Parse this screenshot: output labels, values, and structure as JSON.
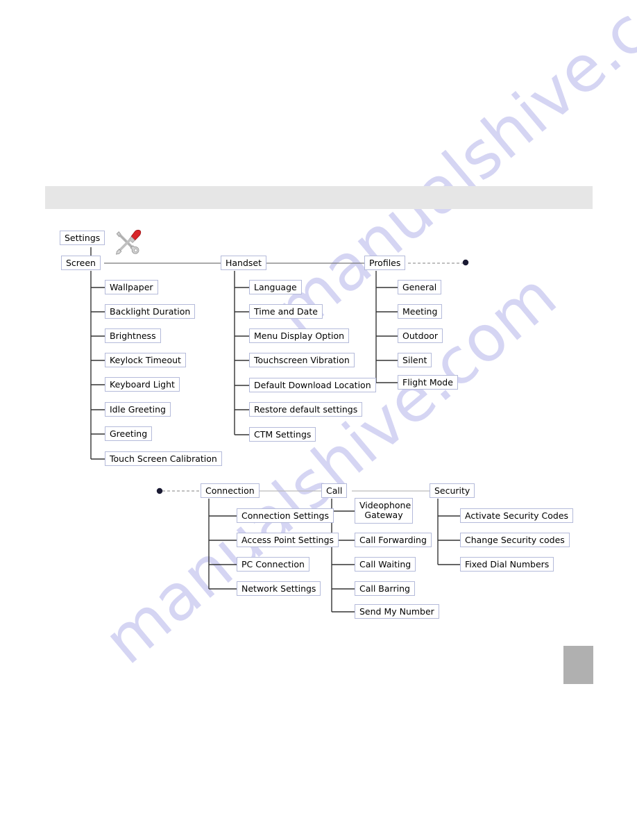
{
  "page": {
    "watermark_text": "manualshive.com",
    "background_color": "#ffffff",
    "header_band_color": "#e6e6e6",
    "page_marker_color": "#b0b0b0",
    "box_border_color": "#b4bada",
    "connector_color": "#333333",
    "dashed_connector_color": "#8a8a8a",
    "dot_marker_color": "#1a1a33"
  },
  "icons": {
    "tools_icon": "tools-wrench-screwdriver-icon"
  },
  "diagram": {
    "type": "menu-tree",
    "root": {
      "label": "Settings"
    },
    "top_row": [
      {
        "label": "Screen"
      },
      {
        "label": "Handset"
      },
      {
        "label": "Profiles"
      }
    ],
    "bottom_row": [
      {
        "label": "Connection"
      },
      {
        "label": "Call"
      },
      {
        "label": "Security"
      }
    ],
    "branches": {
      "screen": [
        "Wallpaper",
        "Backlight Duration",
        "Brightness",
        "Keylock Timeout",
        "Keyboard Light",
        "Idle Greeting",
        "Greeting",
        "Touch Screen Calibration"
      ],
      "handset": [
        "Language",
        "Time and Date",
        "Menu Display Option",
        "Touchscreen Vibration",
        "Default Download Location",
        "Restore default settings",
        "CTM Settings"
      ],
      "profiles": [
        "General",
        "Meeting",
        "Outdoor",
        "Silent",
        "Flight Mode"
      ],
      "connection": [
        "Connection Settings",
        "Access Point Settings",
        "PC Connection",
        "Network Settings"
      ],
      "call": [
        "Videophone Gateway",
        "Call Forwarding",
        "Call Waiting",
        "Call Barring",
        "Send My Number"
      ],
      "security": [
        "Activate Security Codes",
        "Change Security codes",
        "Fixed Dial Numbers"
      ]
    },
    "continuation_markers": [
      {
        "name": "profiles-row-continues",
        "position": "right-of-profiles"
      },
      {
        "name": "connection-row-continued",
        "position": "left-of-connection"
      }
    ]
  }
}
